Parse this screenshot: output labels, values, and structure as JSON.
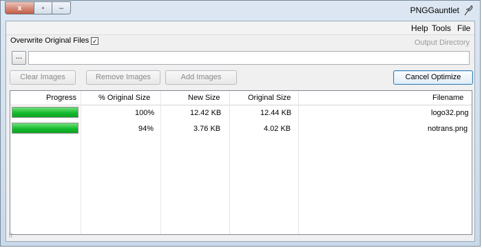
{
  "window": {
    "title": "PNGGauntlet",
    "controls": {
      "close": "x",
      "restore": "▫",
      "minimize": "–"
    }
  },
  "menu": {
    "file": "File",
    "tools": "Tools",
    "help": "Help"
  },
  "options": {
    "overwrite_label": "Overwrite Original Files",
    "overwrite_checked": true,
    "output_directory_label": "Output Directory",
    "output_directory_value": "",
    "browse_label": "..."
  },
  "toolbar": {
    "cancel_optimize": "Cancel Optimize",
    "add_images": "Add Images",
    "remove_images": "Remove Images",
    "clear_images": "Clear Images"
  },
  "table": {
    "columns": [
      "Filename",
      "Original Size",
      "New Size",
      "% Original Size",
      "Progress"
    ],
    "rows": [
      {
        "filename": "logo32.png",
        "original_size": "12.44 KB",
        "new_size": "12.42 KB",
        "percent": "100%",
        "progress": 1.0
      },
      {
        "filename": "notrans.png",
        "original_size": "4.02 KB",
        "new_size": "3.76 KB",
        "percent": "94%",
        "progress": 1.0
      }
    ]
  },
  "colors": {
    "progress": "#12b82a",
    "accent": "#3c7fb1"
  }
}
